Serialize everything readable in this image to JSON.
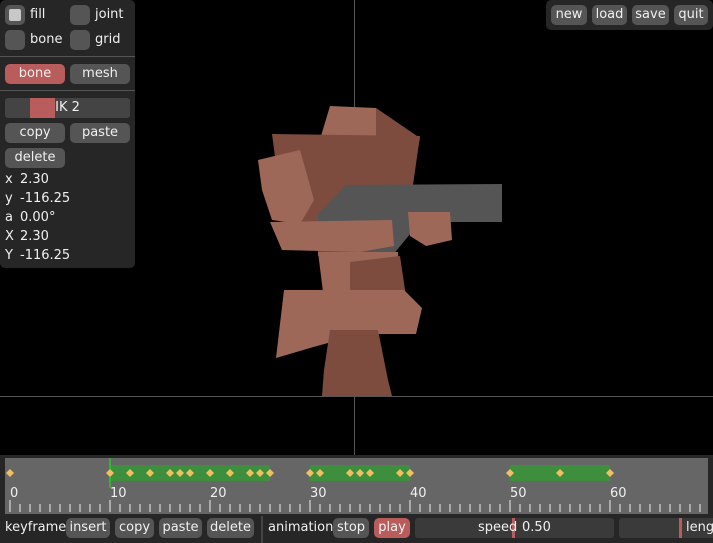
{
  "panel": {
    "checkboxes": [
      {
        "label": "fill",
        "checked": true
      },
      {
        "label": "joint",
        "checked": false
      },
      {
        "label": "bone",
        "checked": false
      },
      {
        "label": "grid",
        "checked": false
      }
    ],
    "mode_tabs": {
      "bone": "bone",
      "mesh": "mesh"
    },
    "ik_slider": {
      "label": "IK  2",
      "value": 2
    },
    "actions": {
      "copy": "copy",
      "paste": "paste",
      "delete": "delete"
    },
    "props": [
      {
        "key": "x",
        "value": "2.30"
      },
      {
        "key": "y",
        "value": "-116.25"
      },
      {
        "key": "a",
        "value": "0.00°"
      },
      {
        "key": "X",
        "value": "2.30"
      },
      {
        "key": "Y",
        "value": "-116.25"
      }
    ]
  },
  "top_menu": {
    "new": "new",
    "load": "load",
    "save": "save",
    "quit": "quit"
  },
  "timeline": {
    "current_frame": 10,
    "tick_labels": [
      "0",
      "10",
      "20",
      "30",
      "40",
      "50",
      "60"
    ],
    "keyframes": [
      0,
      10,
      12,
      14,
      16,
      17,
      18,
      20,
      22,
      24,
      25,
      26,
      30,
      31,
      34,
      35,
      36,
      39,
      40,
      50,
      55,
      60
    ],
    "segments": [
      [
        10,
        26
      ],
      [
        30,
        40
      ],
      [
        50,
        60
      ]
    ]
  },
  "bottom_bar": {
    "keyframe_label": "keyframe",
    "insert": "insert",
    "copy": "copy",
    "paste": "paste",
    "delete": "delete",
    "animation_label": "animation",
    "stop": "stop",
    "play": "play",
    "speed_label": "speed",
    "speed_value": "0.50",
    "length_label": "leng"
  },
  "colors": {
    "accent": "#b85c5c",
    "keyframe": "#f0c060",
    "segment": "#3d8f3d",
    "playhead": "#00ff00",
    "skin": "#9e6858",
    "gun": "#555555"
  }
}
